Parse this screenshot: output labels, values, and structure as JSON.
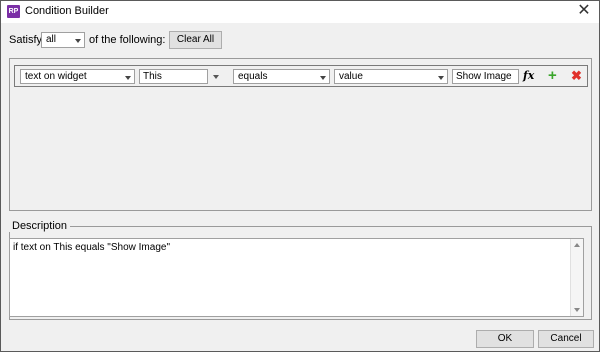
{
  "window": {
    "title": "Condition Builder",
    "app_icon_text": "RP"
  },
  "satisfy": {
    "label": "Satisfy",
    "selected": "all",
    "suffix": "of the following:",
    "clear_all": "Clear All"
  },
  "condition": {
    "type": "text on widget",
    "target": "This",
    "operator": "equals",
    "compare_type": "value",
    "value": "Show Image",
    "fx_label": "fx",
    "add_glyph": "+",
    "delete_glyph": "✖"
  },
  "description": {
    "legend": "Description",
    "text": "if text on This equals \"Show Image\""
  },
  "buttons": {
    "ok": "OK",
    "cancel": "Cancel"
  }
}
